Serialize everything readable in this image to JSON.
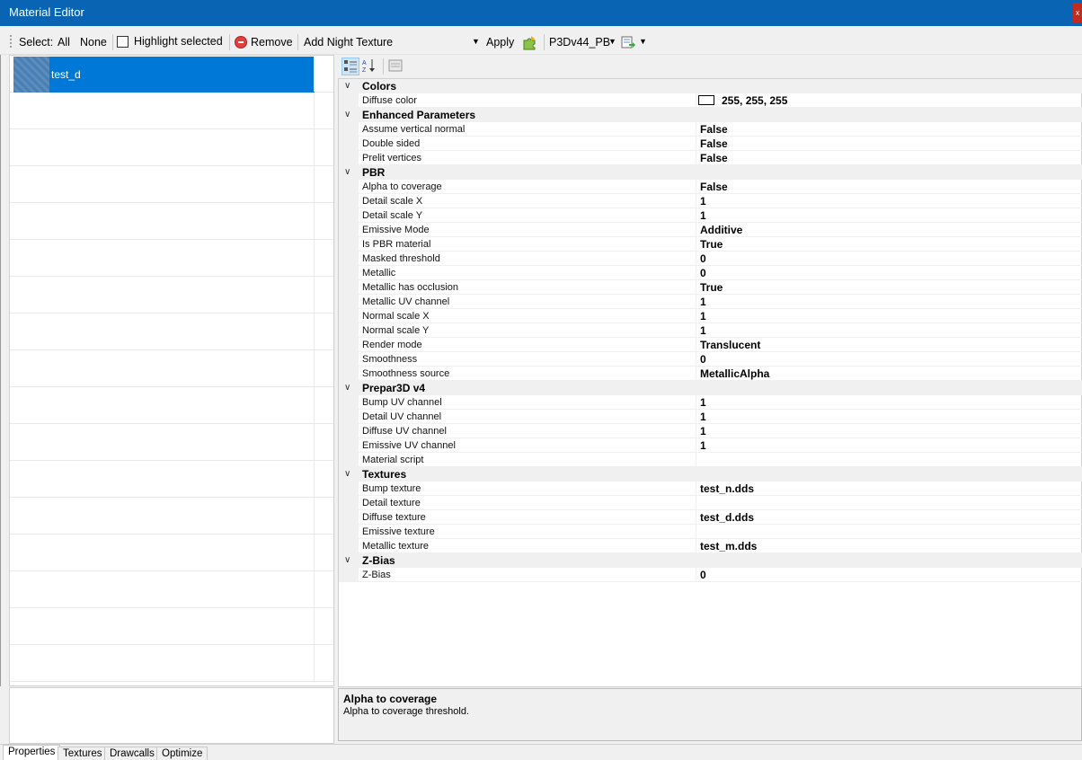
{
  "window": {
    "title": "Material Editor",
    "close_glyph": "x"
  },
  "toolbar": {
    "select_label": "Select:",
    "all_label": "All",
    "none_label": "None",
    "highlight_label": "Highlight selected",
    "remove_label": "Remove",
    "night_texture_label": "Add Night Texture",
    "apply_label": "Apply",
    "profile_value": "P3Dv44_PB"
  },
  "materials": {
    "items": [
      {
        "name": "test_d",
        "selected": true
      }
    ]
  },
  "property_grid": {
    "categories": [
      {
        "label": "Colors",
        "props": [
          {
            "name": "Diffuse color",
            "value": "255, 255, 255",
            "swatch": "#ffffff"
          }
        ]
      },
      {
        "label": "Enhanced Parameters",
        "props": [
          {
            "name": "Assume vertical normal",
            "value": "False"
          },
          {
            "name": "Double sided",
            "value": "False"
          },
          {
            "name": "Prelit vertices",
            "value": "False"
          }
        ]
      },
      {
        "label": "PBR",
        "props": [
          {
            "name": "Alpha to coverage",
            "value": "False"
          },
          {
            "name": "Detail scale X",
            "value": "1"
          },
          {
            "name": "Detail scale Y",
            "value": "1"
          },
          {
            "name": "Emissive Mode",
            "value": "Additive"
          },
          {
            "name": "Is PBR material",
            "value": "True"
          },
          {
            "name": "Masked threshold",
            "value": "0"
          },
          {
            "name": "Metallic",
            "value": "0"
          },
          {
            "name": "Metallic has occlusion",
            "value": "True"
          },
          {
            "name": "Metallic UV channel",
            "value": "1"
          },
          {
            "name": "Normal scale X",
            "value": "1"
          },
          {
            "name": "Normal scale Y",
            "value": "1"
          },
          {
            "name": "Render mode",
            "value": "Translucent"
          },
          {
            "name": "Smoothness",
            "value": "0"
          },
          {
            "name": "Smoothness source",
            "value": "MetallicAlpha"
          }
        ]
      },
      {
        "label": "Prepar3D v4",
        "props": [
          {
            "name": "Bump UV channel",
            "value": "1"
          },
          {
            "name": "Detail UV channel",
            "value": "1"
          },
          {
            "name": "Diffuse UV channel",
            "value": "1"
          },
          {
            "name": "Emissive UV channel",
            "value": "1"
          },
          {
            "name": "Material script",
            "value": ""
          }
        ]
      },
      {
        "label": "Textures",
        "props": [
          {
            "name": "Bump texture",
            "value": "test_n.dds"
          },
          {
            "name": "Detail texture",
            "value": ""
          },
          {
            "name": "Diffuse texture",
            "value": "test_d.dds"
          },
          {
            "name": "Emissive texture",
            "value": ""
          },
          {
            "name": "Metallic texture",
            "value": "test_m.dds"
          }
        ]
      },
      {
        "label": "Z-Bias",
        "props": [
          {
            "name": "Z-Bias",
            "value": "0"
          }
        ]
      }
    ]
  },
  "help": {
    "title": "Alpha to coverage",
    "description": "Alpha to coverage threshold."
  },
  "tabs": [
    {
      "label": "Properties",
      "active": true
    },
    {
      "label": "Textures",
      "active": false
    },
    {
      "label": "Drawcalls",
      "active": false
    },
    {
      "label": "Optimize",
      "active": false
    }
  ],
  "colors": {
    "titlebar": "#0a64b4",
    "selection": "#0078d7"
  }
}
